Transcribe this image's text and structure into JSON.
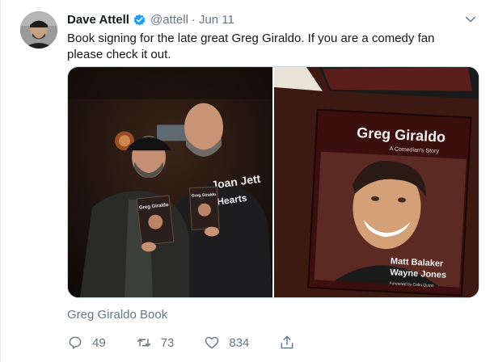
{
  "tweet": {
    "author_name": "Dave Attell",
    "handle": "@attell",
    "separator": "·",
    "date": "Jun 11",
    "text": "Book signing for the late great Greg Giraldo.   If you are a comedy fan please check it out.",
    "media_caption": "Greg Giraldo Book",
    "verified_color": "#1da1f2"
  },
  "media": {
    "book": {
      "title": "Greg Giraldo",
      "subtitle": "A Comedian's Story",
      "author1": "Matt Balaker",
      "author2": "Wayne Jones",
      "foreword": "Foreword by Colin Quinn"
    },
    "shirt_text": {
      "line1": "Joan Jett",
      "line2": "Hearts"
    }
  },
  "actions": {
    "replies": "49",
    "retweets": "73",
    "likes": "834"
  },
  "icons": {
    "reply": "reply-icon",
    "retweet": "retweet-icon",
    "like": "heart-icon",
    "share": "share-icon",
    "caret": "chevron-down-icon",
    "verified": "verified-badge-icon"
  }
}
